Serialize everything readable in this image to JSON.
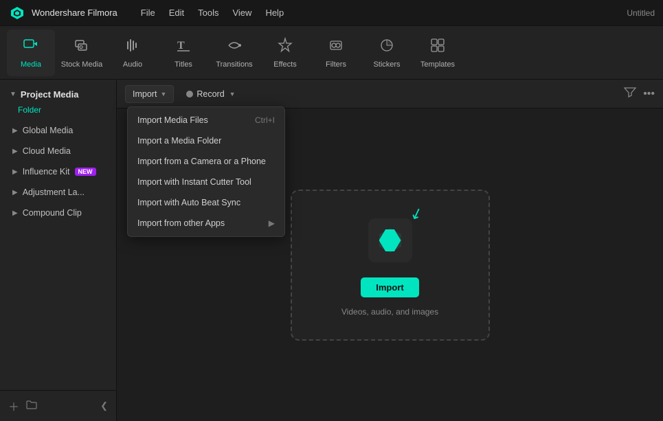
{
  "app": {
    "name": "Wondershare Filmora",
    "title": "Untitled"
  },
  "menu": {
    "items": [
      "File",
      "Edit",
      "Tools",
      "View",
      "Help"
    ]
  },
  "toolbar": {
    "items": [
      {
        "id": "media",
        "label": "Media",
        "active": true
      },
      {
        "id": "stock-media",
        "label": "Stock Media",
        "active": false
      },
      {
        "id": "audio",
        "label": "Audio",
        "active": false
      },
      {
        "id": "titles",
        "label": "Titles",
        "active": false
      },
      {
        "id": "transitions",
        "label": "Transitions",
        "active": false
      },
      {
        "id": "effects",
        "label": "Effects",
        "active": false
      },
      {
        "id": "filters",
        "label": "Filters",
        "active": false
      },
      {
        "id": "stickers",
        "label": "Stickers",
        "active": false
      },
      {
        "id": "templates",
        "label": "Templates",
        "active": false
      }
    ]
  },
  "sidebar": {
    "header": "Project Media",
    "folder_label": "Folder",
    "items": [
      {
        "id": "global-media",
        "label": "Global Media",
        "badge": null
      },
      {
        "id": "cloud-media",
        "label": "Cloud Media",
        "badge": null
      },
      {
        "id": "influence-kit",
        "label": "Influence Kit",
        "badge": "NEW"
      },
      {
        "id": "adjustment-la",
        "label": "Adjustment La...",
        "badge": null
      },
      {
        "id": "compound-clip",
        "label": "Compound Clip",
        "badge": null
      }
    ],
    "bottom": {
      "add_folder": "+",
      "new_folder": "📁",
      "collapse": "<"
    }
  },
  "content_toolbar": {
    "import_label": "Import",
    "record_label": "Record",
    "filter_icon": "filter",
    "more_icon": "more"
  },
  "dropdown": {
    "items": [
      {
        "id": "import-media-files",
        "label": "Import Media Files",
        "shortcut": "Ctrl+I",
        "has_sub": false
      },
      {
        "id": "import-media-folder",
        "label": "Import a Media Folder",
        "shortcut": "",
        "has_sub": false
      },
      {
        "id": "import-from-camera",
        "label": "Import from a Camera or a Phone",
        "shortcut": "",
        "has_sub": false
      },
      {
        "id": "import-instant-cutter",
        "label": "Import with Instant Cutter Tool",
        "shortcut": "",
        "has_sub": false
      },
      {
        "id": "import-auto-beat",
        "label": "Import with Auto Beat Sync",
        "shortcut": "",
        "has_sub": false
      },
      {
        "id": "import-other-apps",
        "label": "Import from other Apps",
        "shortcut": "",
        "has_sub": true
      }
    ]
  },
  "dropzone": {
    "button_label": "Import",
    "hint": "Videos, audio, and images"
  }
}
